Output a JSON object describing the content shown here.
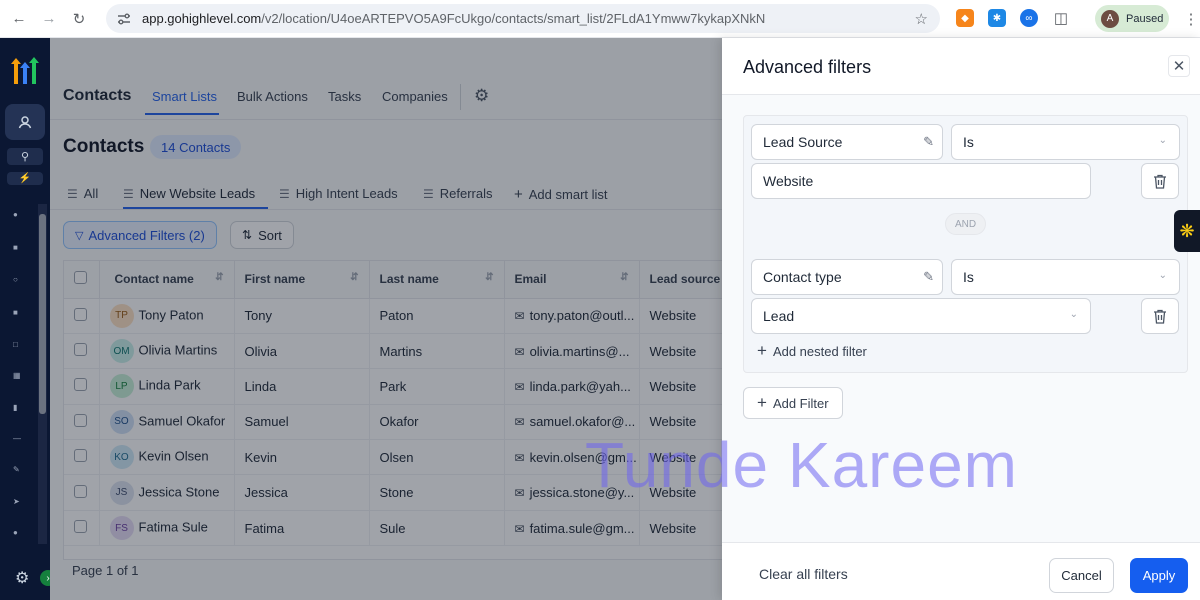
{
  "browser": {
    "url_host": "app.gohighlevel.com",
    "url_path": "/v2/location/U4oeARTEPVO5A9FcUkgo/contacts/smart_list/2FLdA1Ymww7kykapXNkN",
    "profile_initial": "A",
    "profile_status": "Paused",
    "extensions": [
      "metamask-icon",
      "dapp-icon",
      "translate-icon",
      "puzzle-icon"
    ]
  },
  "nav": {
    "title": "Contacts",
    "tabs": [
      "Smart Lists",
      "Bulk Actions",
      "Tasks",
      "Companies"
    ],
    "active_tab": "Smart Lists"
  },
  "page": {
    "title": "Contacts",
    "count_badge": "14 Contacts",
    "smart_lists": [
      "All",
      "New Website Leads",
      "High Intent Leads",
      "Referrals"
    ],
    "active_list": "New Website Leads",
    "add_list_label": "Add smart list",
    "filters_button": "Advanced Filters (2)",
    "sort_button": "Sort",
    "pagination": "Page 1 of 1"
  },
  "table": {
    "columns": [
      "Contact name",
      "First name",
      "Last name",
      "Email",
      "Lead source"
    ],
    "rows": [
      {
        "initials": "TP",
        "name": "Tony Paton",
        "first": "Tony",
        "last": "Paton",
        "email": "tony.paton@outl...",
        "source": "Website",
        "color": "#fde2c4",
        "ink": "#9a5a12"
      },
      {
        "initials": "OM",
        "name": "Olivia Martins",
        "first": "Olivia",
        "last": "Martins",
        "email": "olivia.martins@...",
        "source": "Website",
        "color": "#c9f0ea",
        "ink": "#0f766e"
      },
      {
        "initials": "LP",
        "name": "Linda Park",
        "first": "Linda",
        "last": "Park",
        "email": "linda.park@yah...",
        "source": "Website",
        "color": "#c7f0d8",
        "ink": "#15803d"
      },
      {
        "initials": "SO",
        "name": "Samuel Okafor",
        "first": "Samuel",
        "last": "Okafor",
        "email": "samuel.okafor@...",
        "source": "Website",
        "color": "#cfe0f5",
        "ink": "#1e4f8a"
      },
      {
        "initials": "KO",
        "name": "Kevin Olsen",
        "first": "Kevin",
        "last": "Olsen",
        "email": "kevin.olsen@gm...",
        "source": "Website",
        "color": "#cfe9f7",
        "ink": "#1e6b8f"
      },
      {
        "initials": "JS",
        "name": "Jessica Stone",
        "first": "Jessica",
        "last": "Stone",
        "email": "jessica.stone@y...",
        "source": "Website",
        "color": "#dde3f0",
        "ink": "#3b4a6b"
      },
      {
        "initials": "FS",
        "name": "Fatima Sule",
        "first": "Fatima",
        "last": "Sule",
        "email": "fatima.sule@gm...",
        "source": "Website",
        "color": "#e6dcf5",
        "ink": "#6b3fa0"
      }
    ]
  },
  "drawer": {
    "title": "Advanced filters",
    "filter1": {
      "field": "Lead Source",
      "operator": "Is",
      "value": "Website"
    },
    "connector": "AND",
    "filter2": {
      "field": "Contact type",
      "operator": "Is",
      "value": "Lead"
    },
    "nested_label": "Add nested filter",
    "add_filter_label": "Add Filter",
    "clear_label": "Clear all filters",
    "cancel_label": "Cancel",
    "apply_label": "Apply"
  },
  "watermark": "Tunde Kareem",
  "colors": {
    "accent": "#155eef",
    "rail": "#0b1733"
  }
}
